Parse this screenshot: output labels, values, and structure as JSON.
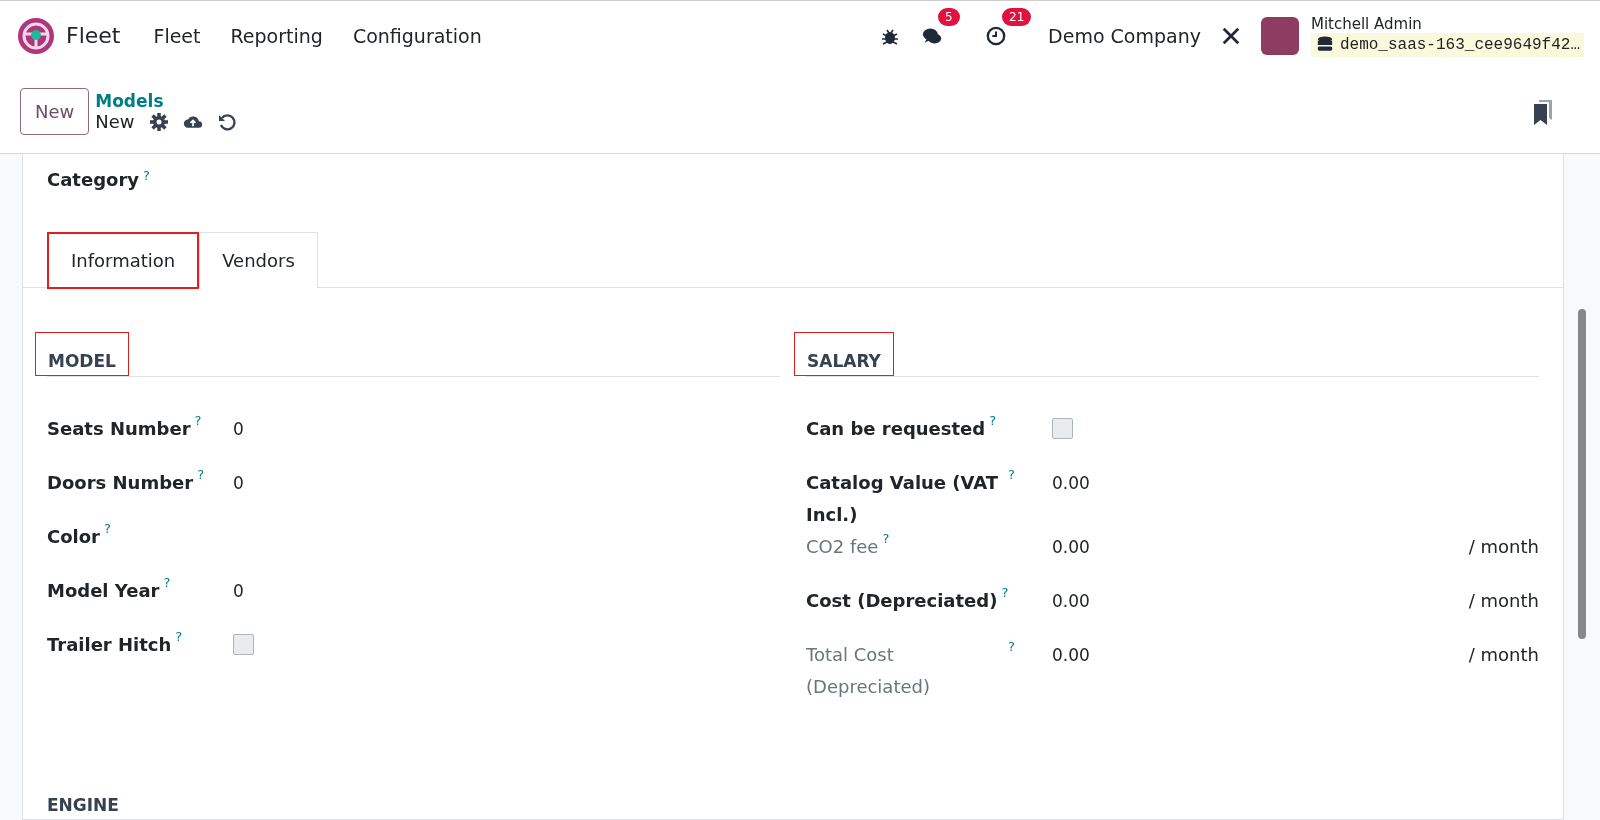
{
  "navbar": {
    "app_name": "Fleet",
    "menu": [
      "Fleet",
      "Reporting",
      "Configuration"
    ],
    "messages_badge": "5",
    "activities_badge": "21",
    "company": "Demo Company",
    "user": {
      "name": "Mitchell Admin",
      "database": "demo_saas-163_cee9649f42…"
    }
  },
  "control_panel": {
    "new_button": "New",
    "breadcrumb": "Models",
    "record": "New"
  },
  "form": {
    "category": {
      "label": "Category",
      "help": "?"
    },
    "tabs": [
      {
        "label": "Information",
        "selected": true,
        "highlighted": true
      },
      {
        "label": "Vendors",
        "selected": false,
        "highlighted": false
      }
    ],
    "groups": [
      {
        "title": "MODEL",
        "highlighted": true,
        "fields": [
          {
            "kind": "text",
            "label": "Seats Number",
            "help": "?",
            "value": "0",
            "muted": false
          },
          {
            "kind": "text",
            "label": "Doors Number",
            "help": "?",
            "value": "0",
            "muted": false
          },
          {
            "kind": "text",
            "label": "Color",
            "help": "?",
            "muted": false
          },
          {
            "kind": "text",
            "label": "Model Year",
            "help": "?",
            "value": "0",
            "muted": false
          },
          {
            "kind": "checkbox",
            "label": "Trailer Hitch",
            "help": "?",
            "checked": false,
            "muted": false
          }
        ]
      },
      {
        "title": "SALARY",
        "highlighted": true,
        "fields": [
          {
            "kind": "checkbox",
            "label": "Can be requested",
            "help": "?",
            "checked": false,
            "muted": false
          },
          {
            "kind": "text",
            "label": "Catalog Value (VAT Incl.)",
            "help": "?",
            "value": "0.00",
            "muted": false
          },
          {
            "kind": "text",
            "label": "CO2 fee",
            "help": "?",
            "value": "0.00",
            "unit": "/ month",
            "muted": true
          },
          {
            "kind": "text",
            "label": "Cost (Depreciated)",
            "help": "?",
            "value": "0.00",
            "unit": "/ month",
            "muted": false
          },
          {
            "kind": "text",
            "label": "Total Cost (Depreciated)",
            "help": "?",
            "value": "0.00",
            "unit": "/ month",
            "muted": true
          }
        ]
      }
    ],
    "next_section": "ENGINE"
  }
}
